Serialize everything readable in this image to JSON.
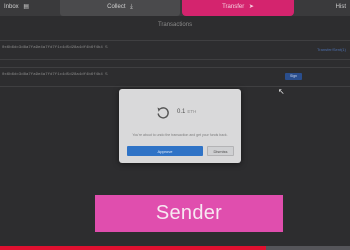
{
  "tabs": {
    "inbox": {
      "label": "Inbox",
      "icon": "inbox-icon"
    },
    "collect": {
      "label": "Collect",
      "icon": "download-icon"
    },
    "transfer": {
      "label": "Transfer",
      "icon": "send-icon",
      "active": true
    },
    "history": {
      "label": "Hist",
      "icon": ""
    }
  },
  "section": {
    "title": "Transactions"
  },
  "transactions": [
    {
      "address": "0x6b6dc3d8a7fa9e4a7fd7f1c4d5d28a4df4b6f4b4 5",
      "link": "Transfer/Sent(1)"
    },
    {
      "address": "0x6b6dc3d8a7fa9e4a7fd7f1c4d5d28a4df4b6f4b4 5",
      "chip": "Sign"
    }
  ],
  "modal": {
    "amount": "0.1",
    "currency": "ETH",
    "message": "You're about to undo the transaction and get your funds back.",
    "approve_label": "Approve",
    "dismiss_label": "Dismiss"
  },
  "banner": {
    "label": "Sender"
  },
  "video_progress": 0.76,
  "colors": {
    "accent": "#d4246e",
    "banner": "#e04eae",
    "primary": "#2f73c6",
    "progress": "#e0102f"
  }
}
